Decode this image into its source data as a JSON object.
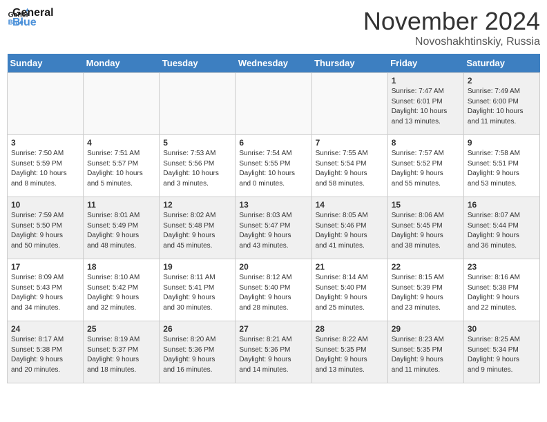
{
  "header": {
    "logo_line1": "General",
    "logo_line2": "Blue",
    "month": "November 2024",
    "location": "Novoshakhtinskiy, Russia"
  },
  "weekdays": [
    "Sunday",
    "Monday",
    "Tuesday",
    "Wednesday",
    "Thursday",
    "Friday",
    "Saturday"
  ],
  "weeks": [
    [
      {
        "day": "",
        "info": "",
        "empty": true
      },
      {
        "day": "",
        "info": "",
        "empty": true
      },
      {
        "day": "",
        "info": "",
        "empty": true
      },
      {
        "day": "",
        "info": "",
        "empty": true
      },
      {
        "day": "",
        "info": "",
        "empty": true
      },
      {
        "day": "1",
        "info": "Sunrise: 7:47 AM\nSunset: 6:01 PM\nDaylight: 10 hours\nand 13 minutes.",
        "empty": false
      },
      {
        "day": "2",
        "info": "Sunrise: 7:49 AM\nSunset: 6:00 PM\nDaylight: 10 hours\nand 11 minutes.",
        "empty": false
      }
    ],
    [
      {
        "day": "3",
        "info": "Sunrise: 7:50 AM\nSunset: 5:59 PM\nDaylight: 10 hours\nand 8 minutes.",
        "empty": false
      },
      {
        "day": "4",
        "info": "Sunrise: 7:51 AM\nSunset: 5:57 PM\nDaylight: 10 hours\nand 5 minutes.",
        "empty": false
      },
      {
        "day": "5",
        "info": "Sunrise: 7:53 AM\nSunset: 5:56 PM\nDaylight: 10 hours\nand 3 minutes.",
        "empty": false
      },
      {
        "day": "6",
        "info": "Sunrise: 7:54 AM\nSunset: 5:55 PM\nDaylight: 10 hours\nand 0 minutes.",
        "empty": false
      },
      {
        "day": "7",
        "info": "Sunrise: 7:55 AM\nSunset: 5:54 PM\nDaylight: 9 hours\nand 58 minutes.",
        "empty": false
      },
      {
        "day": "8",
        "info": "Sunrise: 7:57 AM\nSunset: 5:52 PM\nDaylight: 9 hours\nand 55 minutes.",
        "empty": false
      },
      {
        "day": "9",
        "info": "Sunrise: 7:58 AM\nSunset: 5:51 PM\nDaylight: 9 hours\nand 53 minutes.",
        "empty": false
      }
    ],
    [
      {
        "day": "10",
        "info": "Sunrise: 7:59 AM\nSunset: 5:50 PM\nDaylight: 9 hours\nand 50 minutes.",
        "empty": false
      },
      {
        "day": "11",
        "info": "Sunrise: 8:01 AM\nSunset: 5:49 PM\nDaylight: 9 hours\nand 48 minutes.",
        "empty": false
      },
      {
        "day": "12",
        "info": "Sunrise: 8:02 AM\nSunset: 5:48 PM\nDaylight: 9 hours\nand 45 minutes.",
        "empty": false
      },
      {
        "day": "13",
        "info": "Sunrise: 8:03 AM\nSunset: 5:47 PM\nDaylight: 9 hours\nand 43 minutes.",
        "empty": false
      },
      {
        "day": "14",
        "info": "Sunrise: 8:05 AM\nSunset: 5:46 PM\nDaylight: 9 hours\nand 41 minutes.",
        "empty": false
      },
      {
        "day": "15",
        "info": "Sunrise: 8:06 AM\nSunset: 5:45 PM\nDaylight: 9 hours\nand 38 minutes.",
        "empty": false
      },
      {
        "day": "16",
        "info": "Sunrise: 8:07 AM\nSunset: 5:44 PM\nDaylight: 9 hours\nand 36 minutes.",
        "empty": false
      }
    ],
    [
      {
        "day": "17",
        "info": "Sunrise: 8:09 AM\nSunset: 5:43 PM\nDaylight: 9 hours\nand 34 minutes.",
        "empty": false
      },
      {
        "day": "18",
        "info": "Sunrise: 8:10 AM\nSunset: 5:42 PM\nDaylight: 9 hours\nand 32 minutes.",
        "empty": false
      },
      {
        "day": "19",
        "info": "Sunrise: 8:11 AM\nSunset: 5:41 PM\nDaylight: 9 hours\nand 30 minutes.",
        "empty": false
      },
      {
        "day": "20",
        "info": "Sunrise: 8:12 AM\nSunset: 5:40 PM\nDaylight: 9 hours\nand 28 minutes.",
        "empty": false
      },
      {
        "day": "21",
        "info": "Sunrise: 8:14 AM\nSunset: 5:40 PM\nDaylight: 9 hours\nand 25 minutes.",
        "empty": false
      },
      {
        "day": "22",
        "info": "Sunrise: 8:15 AM\nSunset: 5:39 PM\nDaylight: 9 hours\nand 23 minutes.",
        "empty": false
      },
      {
        "day": "23",
        "info": "Sunrise: 8:16 AM\nSunset: 5:38 PM\nDaylight: 9 hours\nand 22 minutes.",
        "empty": false
      }
    ],
    [
      {
        "day": "24",
        "info": "Sunrise: 8:17 AM\nSunset: 5:38 PM\nDaylight: 9 hours\nand 20 minutes.",
        "empty": false
      },
      {
        "day": "25",
        "info": "Sunrise: 8:19 AM\nSunset: 5:37 PM\nDaylight: 9 hours\nand 18 minutes.",
        "empty": false
      },
      {
        "day": "26",
        "info": "Sunrise: 8:20 AM\nSunset: 5:36 PM\nDaylight: 9 hours\nand 16 minutes.",
        "empty": false
      },
      {
        "day": "27",
        "info": "Sunrise: 8:21 AM\nSunset: 5:36 PM\nDaylight: 9 hours\nand 14 minutes.",
        "empty": false
      },
      {
        "day": "28",
        "info": "Sunrise: 8:22 AM\nSunset: 5:35 PM\nDaylight: 9 hours\nand 13 minutes.",
        "empty": false
      },
      {
        "day": "29",
        "info": "Sunrise: 8:23 AM\nSunset: 5:35 PM\nDaylight: 9 hours\nand 11 minutes.",
        "empty": false
      },
      {
        "day": "30",
        "info": "Sunrise: 8:25 AM\nSunset: 5:34 PM\nDaylight: 9 hours\nand 9 minutes.",
        "empty": false
      }
    ]
  ]
}
